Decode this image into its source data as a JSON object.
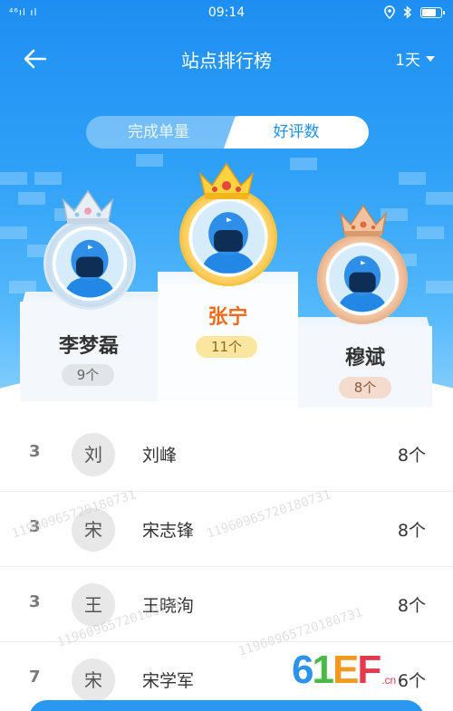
{
  "status_bar": {
    "signal_text": "⁴⁶ıl ıl",
    "time": "09:14",
    "icons": [
      "location-icon",
      "bluetooth-icon",
      "battery-icon"
    ]
  },
  "navbar": {
    "back_icon": "back-arrow-icon",
    "title": "站点排行榜",
    "range_label": "1天"
  },
  "tabs": [
    {
      "label": "完成单量",
      "active": false
    },
    {
      "label": "好评数",
      "active": true
    }
  ],
  "podium": {
    "first": {
      "name": "张宁",
      "count": "11个",
      "crown": "gold"
    },
    "second": {
      "name": "李梦磊",
      "count": "9个",
      "crown": "silver"
    },
    "third": {
      "name": "穆斌",
      "count": "8个",
      "crown": "bronze"
    }
  },
  "rankings": [
    {
      "rank": "3",
      "initial": "刘",
      "name": "刘峰",
      "count": "8个"
    },
    {
      "rank": "3",
      "initial": "宋",
      "name": "宋志锋",
      "count": "8个"
    },
    {
      "rank": "3",
      "initial": "王",
      "name": "王晓洵",
      "count": "8个"
    },
    {
      "rank": "7",
      "initial": "宋",
      "name": "宋学军",
      "count": "6个"
    }
  ],
  "watermark_text": "11960965720180731",
  "logo": {
    "part_6": "6",
    "part_1": "1",
    "part_e": "E",
    "part_f": "F",
    "suffix": ".cn"
  },
  "colors": {
    "header_blue": "#1e8ff2",
    "champion_orange": "#f26b1d",
    "gold": "#f7c343",
    "silver": "#a9c6dc",
    "bronze": "#d48f60"
  }
}
